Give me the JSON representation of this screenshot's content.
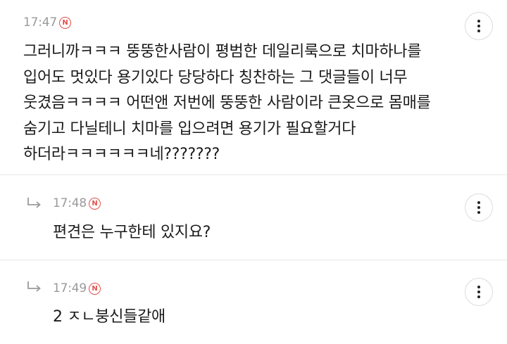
{
  "comments": [
    {
      "time": "17:47",
      "badge": "N",
      "lines": [
        "그러니까ㅋㅋㅋ 뚱뚱한사람이 평범한 데일리룩으로 치마하나를",
        "입어도 멋있다 용기있다 당당하다 칭찬하는 그 댓글들이 너무",
        "웃겼음ㅋㅋㅋㅋ 어떤앤 저번에 뚱뚱한 사람이라 큰옷으로 몸매를",
        "숨기고 다닐테니 치마를 입으려면 용기가 필요할거다",
        "하더라ㅋㅋㅋㅋㅋㅋ네???????"
      ],
      "more_icon": "more-vertical-icon"
    },
    {
      "time": "17:48",
      "badge": "N",
      "lines": [
        "편견은 누구한테 있지요?"
      ],
      "reply_icon": "reply-arrow-icon",
      "more_icon": "more-vertical-icon"
    },
    {
      "time": "17:49",
      "badge": "N",
      "lines": [
        "2 ㅈㄴ붕신들같애"
      ],
      "reply_icon": "reply-arrow-icon",
      "more_icon": "more-vertical-icon"
    }
  ],
  "colors": {
    "badge": "#e2504a",
    "meta_text": "#9a9a9a",
    "divider": "#e8e8e8"
  }
}
